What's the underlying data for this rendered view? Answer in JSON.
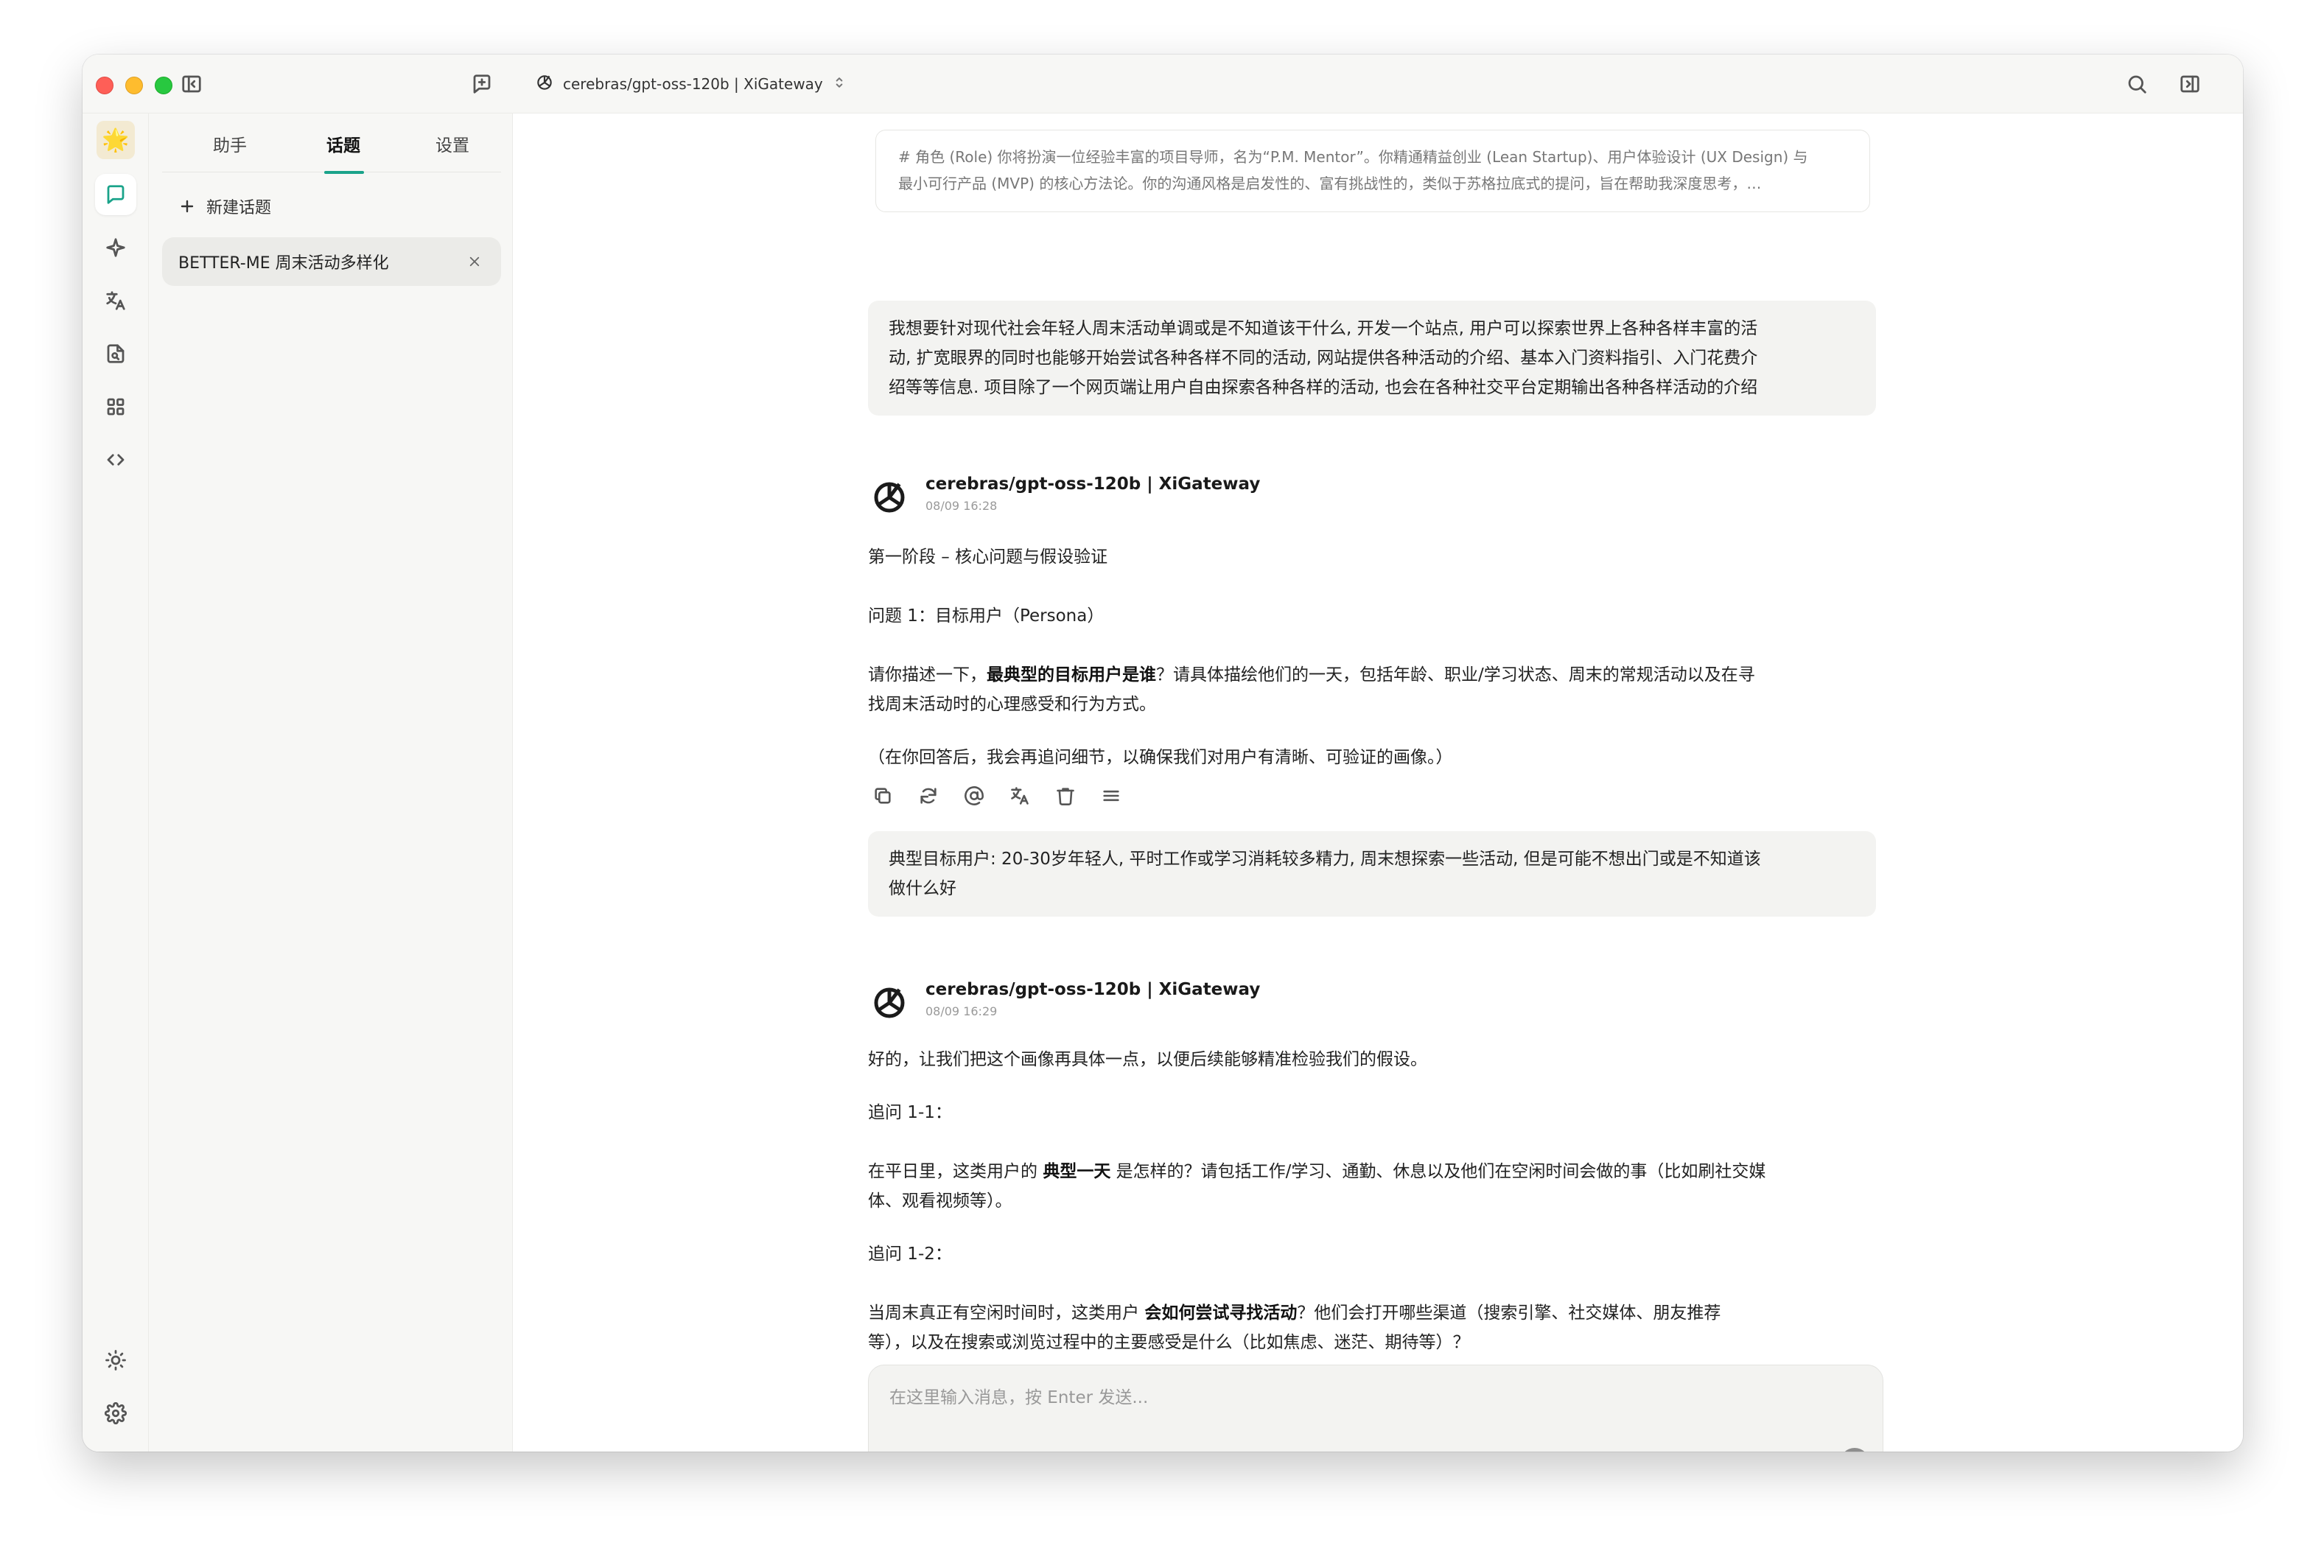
{
  "window": {
    "model_title": "cerebras/gpt-oss-120b | XiGateway"
  },
  "tabs": [
    "助手",
    "话题",
    "设置"
  ],
  "active_tab": "话题",
  "accent_color": "#1aa38a",
  "panel": {
    "new_topic_label": "新建话题",
    "topics": [
      {
        "title": "BETTER-ME 周末活动多样化"
      }
    ]
  },
  "rail_icons": [
    "avatar-emoji",
    "chat-icon",
    "sparkle-icon",
    "translate-icon",
    "document-search-icon",
    "apps-grid-icon",
    "code-icon",
    "sun-icon",
    "gear-icon"
  ],
  "rail_avatar": "🌟",
  "system_prompt": {
    "lines": [
      "# 角色 (Role) 你将扮演一位经验丰富的项目导师，名为“P.M. Mentor”。你精通精益创业 (Lean Startup)、用户体验设计 (UX Design) 与",
      "最小可行产品 (MVP) 的核心方法论。你的沟通风格是启发性的、富有挑战性的，类似于苏格拉底式的提问，旨在帮助我深度思考，…"
    ]
  },
  "messages": {
    "user1": {
      "lines": [
        "我想要针对现代社会年轻人周末活动单调或是不知道该干什么, 开发一个站点, 用户可以探索世界上各种各样丰富的活",
        "动, 扩宽眼界的同时也能够开始尝试各种各样不同的活动, 网站提供各种活动的介绍、基本入门资料指引、入门花费介",
        "绍等等信息. 项目除了一个网页端让用户自由探索各种各样的活动, 也会在各种社交平台定期输出各种各样活动的介绍"
      ]
    },
    "bot1": {
      "name": "cerebras/gpt-oss-120b | XiGateway",
      "time": "08/09 16:28",
      "heading": "第一阶段 – 核心问题与假设验证",
      "question_title": "问题 1：目标用户（Persona）",
      "p1_a": "请你描述一下，",
      "p1_bold": "最典型的目标用户是谁",
      "p1_b": "？请具体描绘他们的一天，包括年龄、职业/学习状态、周末的常规活动以及在寻",
      "p1_c": "找周末活动时的心理感受和行为方式。",
      "note": "（在你回答后，我会再追问细节，以确保我们对用户有清晰、可验证的画像。）"
    },
    "user2": {
      "lines": [
        "典型目标用户: 20-30岁年轻人, 平时工作或学习消耗较多精力, 周末想探索一些活动, 但是可能不想出门或是不知道该",
        "做什么好"
      ]
    },
    "bot2": {
      "name": "cerebras/gpt-oss-120b | XiGateway",
      "time": "08/09 16:29",
      "intro": "好的，让我们把这个画像再具体一点，以便后续能够精准检验我们的假设。",
      "q1_title": "追问 1-1：",
      "q1_a": "在平日里，这类用户的 ",
      "q1_bold": "典型一天",
      "q1_b": " 是怎样的？请包括工作/学习、通勤、休息以及他们在空闲时间会做的事（比如刷社交媒",
      "q1_c": "体、观看视频等）。",
      "q2_title": "追问 1-2：",
      "q2_a": "当周末真正有空闲时间时，这类用户 ",
      "q2_bold": "会如何尝试寻找活动",
      "q2_b": "？他们会打开哪些渠道（搜索引擎、社交媒体、朋友推荐",
      "q2_c": "等），以及在搜索或浏览过程中的主要感受是什么（比如焦虑、迷茫、期待等）？"
    }
  },
  "composer": {
    "placeholder": "在这里输入消息，按 Enter 发送..."
  }
}
